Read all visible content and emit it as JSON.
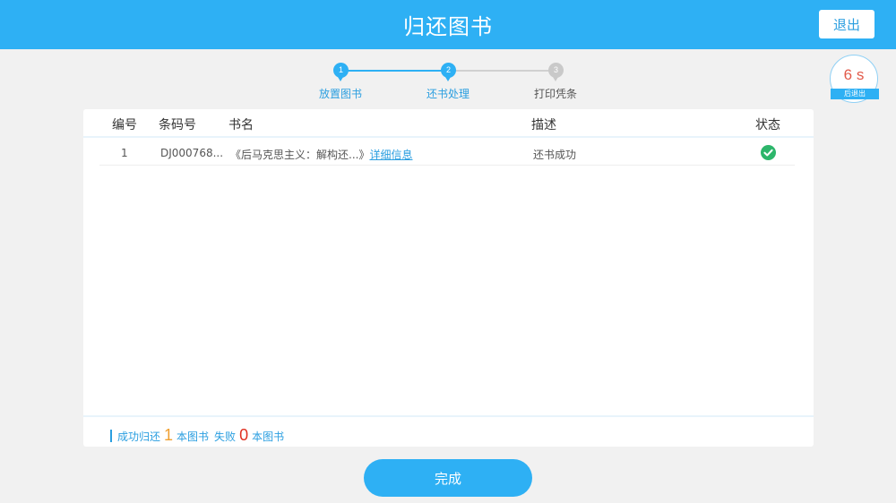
{
  "header": {
    "title": "归还图书",
    "exit_label": "退出"
  },
  "countdown": {
    "value": "6 s",
    "label": "后退出",
    "accent": "#e25a4a"
  },
  "stepper": {
    "steps": [
      {
        "num": "1",
        "label": "放置图书",
        "state": "done"
      },
      {
        "num": "2",
        "label": "还书处理",
        "state": "active"
      },
      {
        "num": "3",
        "label": "打印凭条",
        "state": "pending"
      }
    ]
  },
  "table": {
    "headers": [
      "编号",
      "条码号",
      "书名",
      "描述",
      "状态"
    ],
    "rows": [
      {
        "index": "1",
        "barcode": "DJ000768...",
        "title": "《后马克思主义：解构还...》",
        "detail_link": "详细信息",
        "description": "还书成功",
        "status_icon": "check-circle-icon",
        "status_color": "#2db66b"
      }
    ]
  },
  "summary": {
    "success_prefix": "成功归还",
    "success_count": "1",
    "success_suffix": "本图书",
    "fail_prefix": "失败",
    "fail_count": "0",
    "fail_suffix": "本图书"
  },
  "done_label": "完成",
  "colors": {
    "primary": "#2eb0f4",
    "link": "#2a9ee0",
    "success_count": "#f0a030",
    "fail_count": "#e03020"
  }
}
